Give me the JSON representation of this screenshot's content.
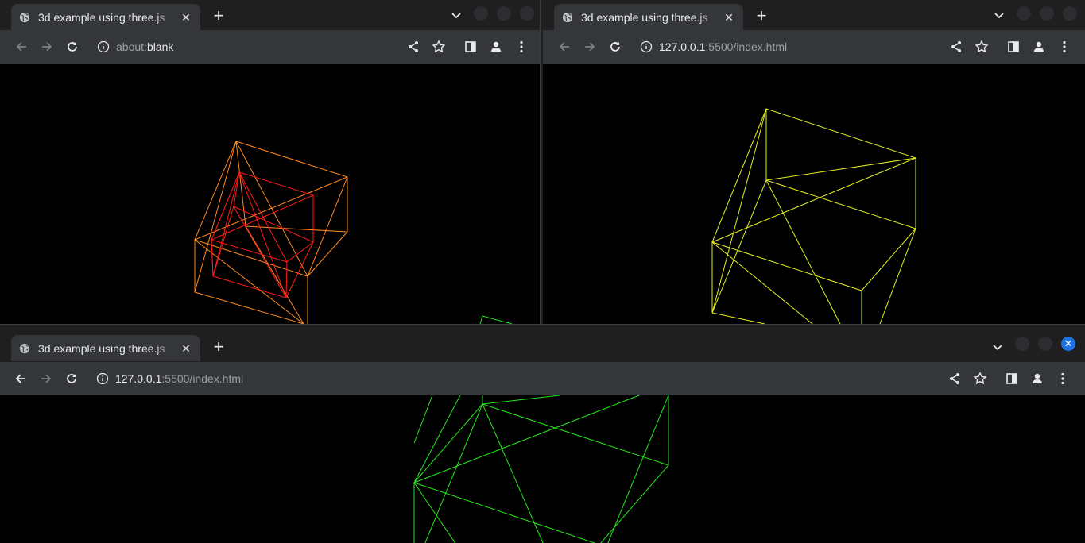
{
  "windows": [
    {
      "tab_title": "3d example using three.js",
      "url_host": "about:",
      "url_rest": "blank",
      "wireframe_colors": [
        "#ff8a1e",
        "#ff1a1a"
      ]
    },
    {
      "tab_title": "3d example using three.js",
      "url_host": "127.0.0.1",
      "url_rest": ":5500/index.html",
      "wireframe_colors": [
        "#e6f020"
      ]
    },
    {
      "tab_title": "3d example using three.js",
      "url_host": "127.0.0.1",
      "url_rest": ":5500/index.html",
      "wireframe_colors": [
        "#27e61c"
      ]
    }
  ],
  "icons": {
    "tab_favicon": "globe-icon",
    "close": "close-icon",
    "new_tab": "plus-icon",
    "back": "arrow-left-icon",
    "forward": "arrow-right-icon",
    "reload": "reload-icon",
    "site_info": "info-icon",
    "share": "share-icon",
    "bookmark": "star-icon",
    "side_panel": "side-panel-icon",
    "profile": "profile-icon",
    "menu": "kebab-menu-icon"
  }
}
